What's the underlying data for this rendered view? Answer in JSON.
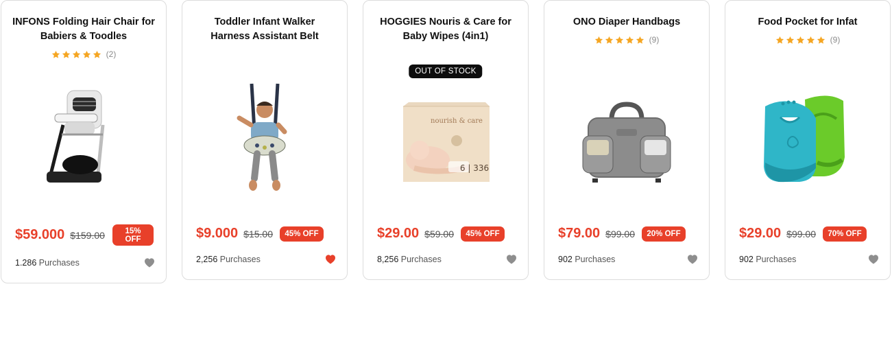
{
  "colors": {
    "accent": "#e8402a",
    "star": "#f5a623",
    "heart_inactive": "#8e8e8e",
    "heart_active": "#e8402a"
  },
  "products": [
    {
      "title_line1": "INFONS Folding Hair Chair for",
      "title_line2": "Babiers & Toodles",
      "rating_count": "(2)",
      "stock_badge": "",
      "image": "high-chair-icon",
      "price": "$59.000",
      "old_price": "$159.00",
      "discount_line1": "15%",
      "discount_line2": "OFF",
      "purchases_number": "1.286",
      "purchases_label": "Purchases",
      "favorited": false
    },
    {
      "title_line1": "Toddler Infant Walker",
      "title_line2": "Harness Assistant Belt",
      "rating_count": "",
      "stock_badge": "",
      "image": "baby-jumper-icon",
      "price": "$9.000",
      "old_price": "$15.00",
      "discount_line1": "45% OFF",
      "discount_line2": "",
      "purchases_number": "2,256",
      "purchases_label": "Purchases",
      "favorited": true
    },
    {
      "title_line1": "HOGGIES Nouris & Care for",
      "title_line2": "Baby Wipes (4in1)",
      "rating_count": "",
      "stock_badge": "OUT OF STOCK",
      "image": "wipes-box-icon",
      "box_text_brand": "nourish & care",
      "box_text_count": "6 | 336",
      "price": "$29.00",
      "old_price": "$59.00",
      "discount_line1": "45% OFF",
      "discount_line2": "",
      "purchases_number": "8,256",
      "purchases_label": "Purchases",
      "favorited": false
    },
    {
      "title_line1": "ONO Diaper Handbags",
      "title_line2": "",
      "rating_count": "(9)",
      "stock_badge": "",
      "image": "diaper-bag-icon",
      "price": "$79.00",
      "old_price": "$99.00",
      "discount_line1": "20% OFF",
      "discount_line2": "",
      "purchases_number": "902",
      "purchases_label": "Purchases",
      "favorited": false
    },
    {
      "title_line1": "Food Pocket for Infat",
      "title_line2": "",
      "rating_count": "(9)",
      "stock_badge": "",
      "image": "baby-bibs-icon",
      "price": "$29.00",
      "old_price": "$99.00",
      "discount_line1": "70% OFF",
      "discount_line2": "",
      "purchases_number": "902",
      "purchases_label": "Purchases",
      "favorited": false
    }
  ]
}
